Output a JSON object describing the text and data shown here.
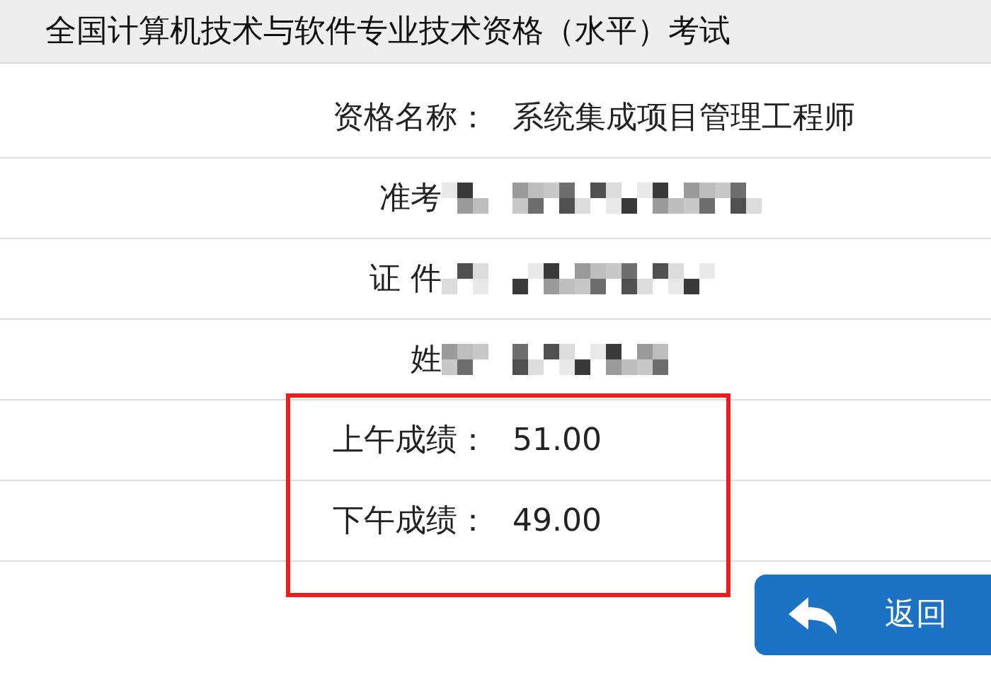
{
  "header": {
    "title": "全国计算机技术与软件专业技术资格（水平）考试"
  },
  "rows": [
    {
      "label": "资格名称：",
      "value": "系统集成项目管理工程师",
      "redacted": false
    },
    {
      "label": "准考",
      "redacted": true
    },
    {
      "label": "证 件",
      "redacted": true
    },
    {
      "label": "姓",
      "redacted": true
    }
  ],
  "scores": {
    "highlighted": true,
    "rows": [
      {
        "label": "上午成绩：",
        "value": "51.00"
      },
      {
        "label": "下午成绩：",
        "value": "49.00"
      }
    ]
  },
  "back_button": {
    "label": "返回"
  }
}
